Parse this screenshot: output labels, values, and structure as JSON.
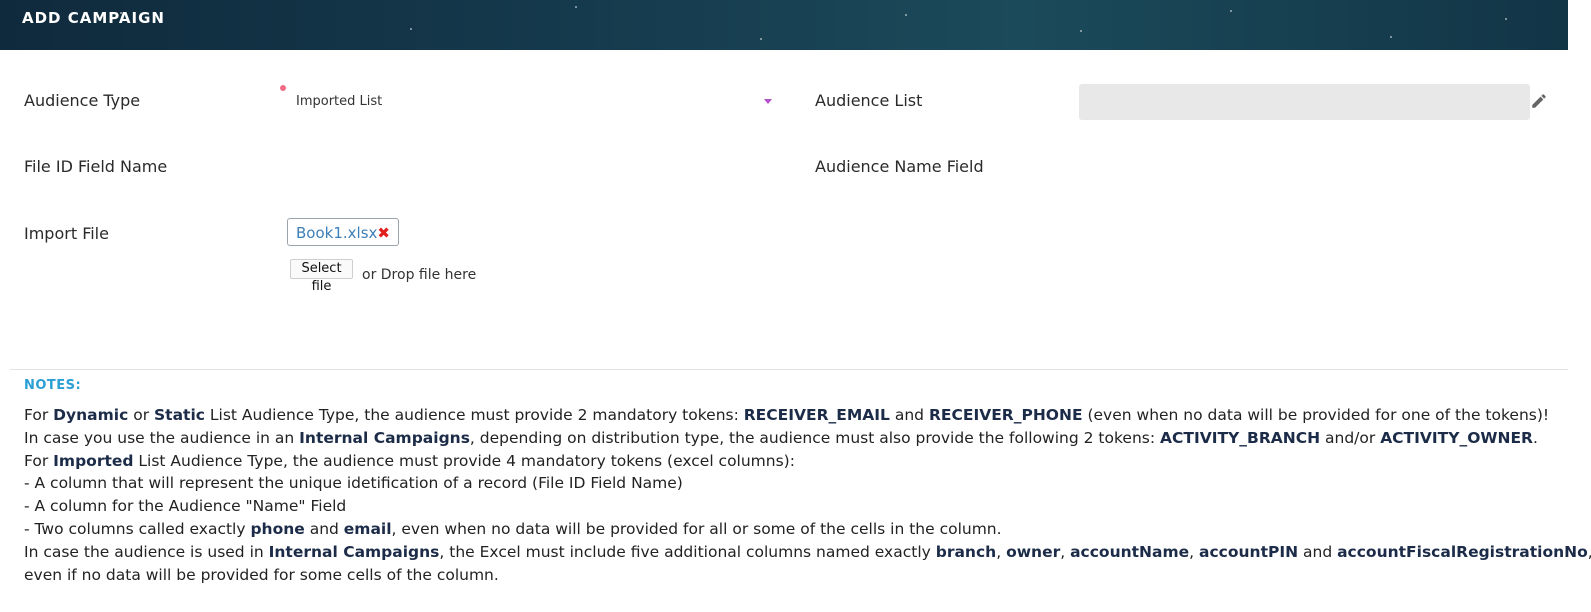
{
  "header": {
    "title": "ADD CAMPAIGN"
  },
  "form": {
    "audience_type_label": "Audience Type",
    "audience_type_value": "Imported List",
    "audience_list_label": "Audience List",
    "audience_list_value": "",
    "file_id_label": "File ID Field Name",
    "audience_name_label": "Audience Name Field",
    "import_file_label": "Import File",
    "file_name": "Book1.xlsx",
    "select_file_label": "Select file",
    "drop_hint": "or Drop file here"
  },
  "notes": {
    "title": "NOTES:",
    "l1": {
      "a": "For ",
      "b": "Dynamic",
      "c": " or ",
      "d": "Static",
      "e": " List Audience Type, the audience must provide 2 mandatory tokens: ",
      "f": "RECEIVER_EMAIL",
      "g": " and ",
      "h": "RECEIVER_PHONE",
      "i": " (even when no data will be provided for one of the tokens)!"
    },
    "l2": {
      "a": "In case you use the audience in an ",
      "b": "Internal Campaigns",
      "c": ", depending on distribution type, the audience must also provide the following 2 tokens: ",
      "d": "ACTIVITY_BRANCH",
      "e": " and/or ",
      "f": "ACTIVITY_OWNER",
      "g": "."
    },
    "l3": {
      "a": "For ",
      "b": "Imported",
      "c": " List Audience Type, the audience must provide 4 mandatory tokens (excel columns):"
    },
    "l4": "- A column that will represent the unique idetification of a record (File ID Field Name)",
    "l5": "- A column for the Audience \"Name\" Field",
    "l6": {
      "a": "- Two columns called exactly ",
      "b": "phone",
      "c": " and ",
      "d": "email",
      "e": ", even when no data will be provided for all or some of the cells in the column."
    },
    "l7": {
      "a": "In case the audience is used in ",
      "b": "Internal Campaigns",
      "c": ", the Excel must include five additional columns named exactly ",
      "d": "branch",
      "e": ", ",
      "f": "owner",
      "g": ", ",
      "h": "accountName",
      "i": ", ",
      "j": "accountPIN",
      "k": " and ",
      "l": "accountFiscalRegistrationNo",
      "m": ","
    },
    "l8": "even if no data will be provided for some cells of the column."
  },
  "colors": {
    "header_bg": "#15394c",
    "notes_title": "#2a9fd6",
    "required_dot": "#f06c85",
    "remove_x": "#e0201f",
    "file_link": "#3d7fb8"
  },
  "icons": {
    "edit": "pencil-icon",
    "remove_file": "close-icon",
    "dropdown": "chevron-down-icon"
  }
}
